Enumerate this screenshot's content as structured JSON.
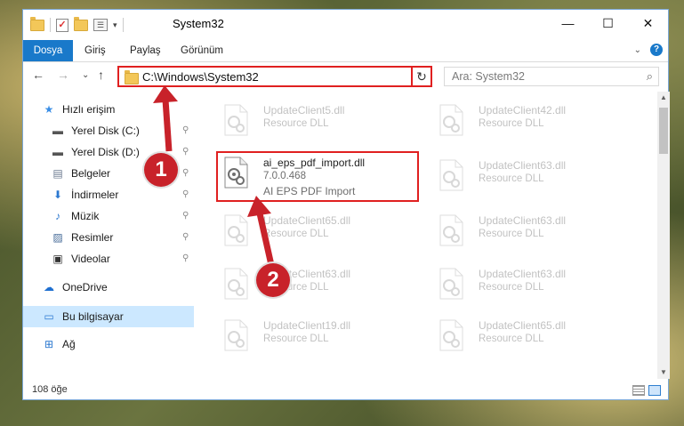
{
  "window": {
    "title": "System32",
    "controls": {
      "minimize": "—",
      "maximize": "☐",
      "close": "✕"
    }
  },
  "quick_access_toolbar": {
    "arrow": "▾"
  },
  "ribbon": {
    "tabs": [
      {
        "label": "Dosya",
        "active": true
      },
      {
        "label": "Giriş"
      },
      {
        "label": "Paylaş"
      },
      {
        "label": "Görünüm"
      }
    ],
    "expand": "⌄",
    "help": "?"
  },
  "nav": {
    "back": "←",
    "forward": "→",
    "recent": "⌄",
    "up": "↑",
    "address": "C:\\Windows\\System32",
    "address_dropdown": "⌄",
    "refresh": "↻",
    "search_placeholder": "Ara: System32",
    "search_icon": "⌕"
  },
  "sidebar": {
    "items": [
      {
        "label": "Hızlı erişim",
        "icon": "star-icon",
        "glyph": "★",
        "color": "#3a8ee6",
        "pinned": false
      },
      {
        "label": "Yerel Disk (C:)",
        "icon": "drive-icon",
        "glyph": "▬",
        "color": "#555555",
        "pinned": true
      },
      {
        "label": "Yerel Disk (D:)",
        "icon": "drive-icon",
        "glyph": "▬",
        "color": "#555555",
        "pinned": true
      },
      {
        "label": "Belgeler",
        "icon": "documents-icon",
        "glyph": "▤",
        "color": "#6b7a8f",
        "pinned": true
      },
      {
        "label": "İndirmeler",
        "icon": "download-icon",
        "glyph": "⬇",
        "color": "#2b78d0",
        "pinned": true
      },
      {
        "label": "Müzik",
        "icon": "music-icon",
        "glyph": "♪",
        "color": "#2b78d0",
        "pinned": true
      },
      {
        "label": "Resimler",
        "icon": "pictures-icon",
        "glyph": "▨",
        "color": "#4a6e9a",
        "pinned": true
      },
      {
        "label": "Videolar",
        "icon": "videos-icon",
        "glyph": "▣",
        "color": "#333333",
        "pinned": true
      },
      {
        "label": "OneDrive",
        "icon": "cloud-icon",
        "glyph": "☁",
        "color": "#1e6fd0",
        "pinned": false
      },
      {
        "label": "Bu bilgisayar",
        "icon": "computer-icon",
        "glyph": "▭",
        "color": "#2b78d0",
        "pinned": false,
        "selected": true
      },
      {
        "label": "Ağ",
        "icon": "network-icon",
        "glyph": "⊞",
        "color": "#2b78d0",
        "pinned": false
      }
    ],
    "pin_glyph": "⚲"
  },
  "files": [
    {
      "name": "UpdateClient5.dll",
      "desc": "Resource DLL"
    },
    {
      "name": "UpdateClient42.dll",
      "desc": "Resource DLL"
    },
    {
      "name": "ai_eps_pdf_import.dll",
      "version": "7.0.0.468",
      "desc": "AI EPS PDF Import",
      "highlighted": true
    },
    {
      "name": "UpdateClient63.dll",
      "desc": "Resource DLL"
    },
    {
      "name": "UpdateClient65.dll",
      "desc": "Resource DLL"
    },
    {
      "name": "UpdateClient63.dll",
      "desc": "Resource DLL"
    },
    {
      "name": "UpdateClient63.dll",
      "desc": "Resource DLL"
    },
    {
      "name": "UpdateClient63.dll",
      "desc": "Resource DLL"
    },
    {
      "name": "UpdateClient19.dll",
      "desc": "Resource DLL"
    },
    {
      "name": "UpdateClient65.dll",
      "desc": "Resource DLL"
    }
  ],
  "status": {
    "count": "108 öğe"
  },
  "annotations": [
    {
      "label": "1",
      "color": "#c8222a"
    },
    {
      "label": "2",
      "color": "#c8222a"
    }
  ],
  "colors": {
    "accent": "#1979ca",
    "highlight": "#e02020",
    "selection": "#cce8ff"
  }
}
